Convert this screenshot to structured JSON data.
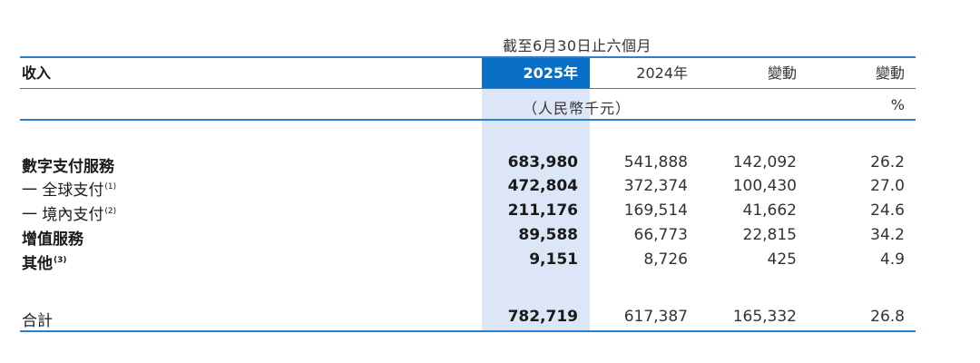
{
  "header": {
    "period": "截至6月30日止六個月",
    "label": "收入",
    "col_2025": "2025年",
    "col_2024": "2024年",
    "col_change": "變動",
    "col_pct": "變動",
    "unit": "（人民幣千元）",
    "pct_sign": "%"
  },
  "rows": [
    {
      "label": "數字支付服務",
      "note": "",
      "v2025": "683,980",
      "v2024": "541,888",
      "change": "142,092",
      "pct": "26.2"
    },
    {
      "label": "一 全球支付",
      "note": "(1)",
      "v2025": "472,804",
      "v2024": "372,374",
      "change": "100,430",
      "pct": "27.0"
    },
    {
      "label": "一 境內支付",
      "note": "(2)",
      "v2025": "211,176",
      "v2024": "169,514",
      "change": "41,662",
      "pct": "24.6"
    },
    {
      "label": "增值服務",
      "note": "",
      "v2025": "89,588",
      "v2024": "66,773",
      "change": "22,815",
      "pct": "34.2"
    },
    {
      "label": "其他",
      "note": "(3)",
      "v2025": "9,151",
      "v2024": "8,726",
      "change": "425",
      "pct": "4.9"
    }
  ],
  "total": {
    "label": "合計",
    "v2025": "782,719",
    "v2024": "617,387",
    "change": "165,332",
    "pct": "26.8"
  }
}
